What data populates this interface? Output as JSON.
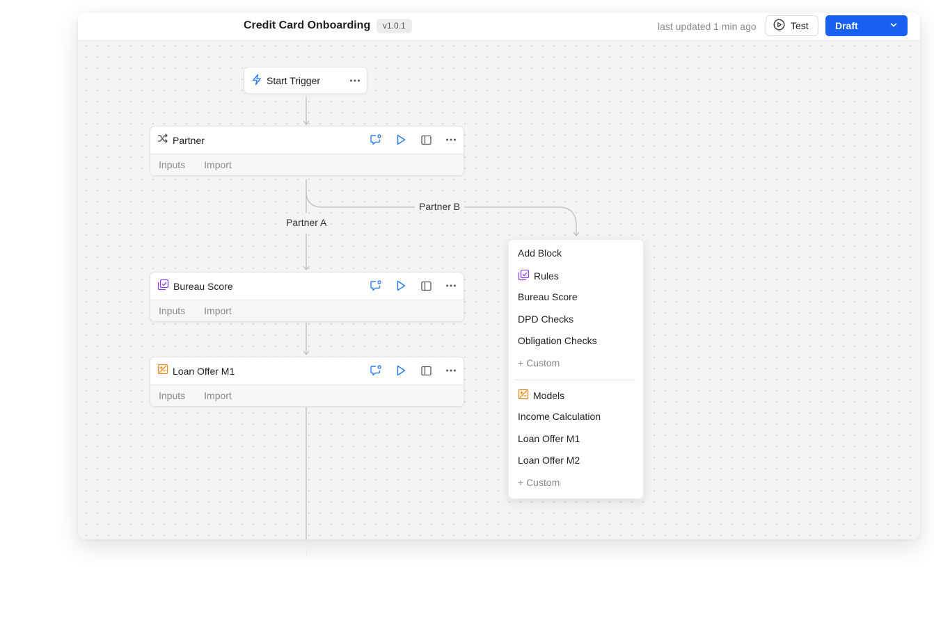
{
  "header": {
    "title": "Credit Card Onboarding",
    "version": "v1.0.1",
    "updated": "last updated 1 min ago",
    "test_label": "Test",
    "draft_label": "Draft"
  },
  "trigger": {
    "label": "Start Trigger",
    "icon": "lightning-icon"
  },
  "nodes": [
    {
      "label": "Partner",
      "icon": "shuffle-icon",
      "inputs": "Inputs",
      "import": "Import"
    },
    {
      "label": "Bureau Score",
      "icon": "rules-icon",
      "inputs": "Inputs",
      "import": "Import"
    },
    {
      "label": "Loan Offer M1",
      "icon": "model-icon",
      "inputs": "Inputs",
      "import": "Import"
    }
  ],
  "edges": {
    "branch_a": "Partner A",
    "branch_b": "Partner B"
  },
  "menu": {
    "title": "Add Block",
    "rules_header": "Rules",
    "rules_items": [
      "Bureau Score",
      "DPD Checks",
      "Obligation Checks"
    ],
    "rules_custom": "+ Custom",
    "models_header": "Models",
    "models_items": [
      "Income Calculation",
      "Loan Offer M1",
      "Loan Offer M2"
    ],
    "models_custom": "+ Custom"
  },
  "colors": {
    "accent": "#1760f2",
    "icon_blue": "#2a7cf0",
    "rules_purple": "#8d3ff0",
    "model_orange": "#ef8a17"
  }
}
